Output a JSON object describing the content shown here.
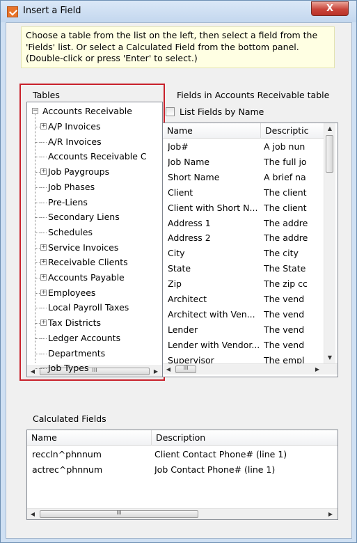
{
  "window": {
    "title": "Insert a Field",
    "close_glyph": "X"
  },
  "info_text": "Choose a table from the list on the left, then select a field from the 'Fields' list.  Or select a Calculated Field from the bottom panel. (Double-click or press 'Enter' to select.)",
  "tables": {
    "label": "Tables",
    "root": "Accounts Receivable",
    "items": [
      {
        "label": "A/P Invoices",
        "expandable": true
      },
      {
        "label": "A/R Invoices",
        "expandable": false
      },
      {
        "label": "Accounts Receivable C",
        "expandable": false
      },
      {
        "label": "Job Paygroups",
        "expandable": true
      },
      {
        "label": "Job Phases",
        "expandable": false
      },
      {
        "label": "Pre-Liens",
        "expandable": false
      },
      {
        "label": "Secondary Liens",
        "expandable": false
      },
      {
        "label": "Schedules",
        "expandable": false
      },
      {
        "label": "Service Invoices",
        "expandable": true
      },
      {
        "label": "Receivable Clients",
        "expandable": true
      },
      {
        "label": "Accounts Payable",
        "expandable": true
      },
      {
        "label": "Employees",
        "expandable": true
      },
      {
        "label": "Local Payroll Taxes",
        "expandable": false
      },
      {
        "label": "Tax Districts",
        "expandable": true
      },
      {
        "label": "Ledger Accounts",
        "expandable": false
      },
      {
        "label": "Departments",
        "expandable": false
      },
      {
        "label": "Job Types",
        "expandable": false
      }
    ]
  },
  "fields": {
    "label": "Fields in Accounts Receivable table",
    "list_by_name_label": "List Fields by Name",
    "list_by_name_checked": false,
    "columns": [
      "Name",
      "Descriptic"
    ],
    "rows": [
      [
        "Job#",
        "A job nun"
      ],
      [
        "Job Name",
        "The full jo"
      ],
      [
        "Short Name",
        "A brief na"
      ],
      [
        "Client",
        "The client"
      ],
      [
        "Client with Short N...",
        "The client"
      ],
      [
        "Address 1",
        "The addre"
      ],
      [
        "Address 2",
        "The addre"
      ],
      [
        "City",
        "The city"
      ],
      [
        "State",
        "The State"
      ],
      [
        "Zip",
        "The zip cc"
      ],
      [
        "Architect",
        "The vend"
      ],
      [
        "Architect with Ven...",
        "The vend"
      ],
      [
        "Lender",
        "The vend"
      ],
      [
        "Lender with Vendor...",
        "The vend"
      ],
      [
        "Supervisor",
        "The empl"
      ]
    ]
  },
  "calculated": {
    "label": "Calculated Fields",
    "columns": [
      "Name",
      "Description"
    ],
    "rows": [
      [
        "reccln^phnnum",
        "Client Contact Phone# (line 1)"
      ],
      [
        "actrec^phnnum",
        "Job Contact Phone# (line 1)"
      ]
    ]
  },
  "scrollbar_glyphs": {
    "left": "◀",
    "right": "▶",
    "up": "▲",
    "down": "▼",
    "grip": "III"
  }
}
